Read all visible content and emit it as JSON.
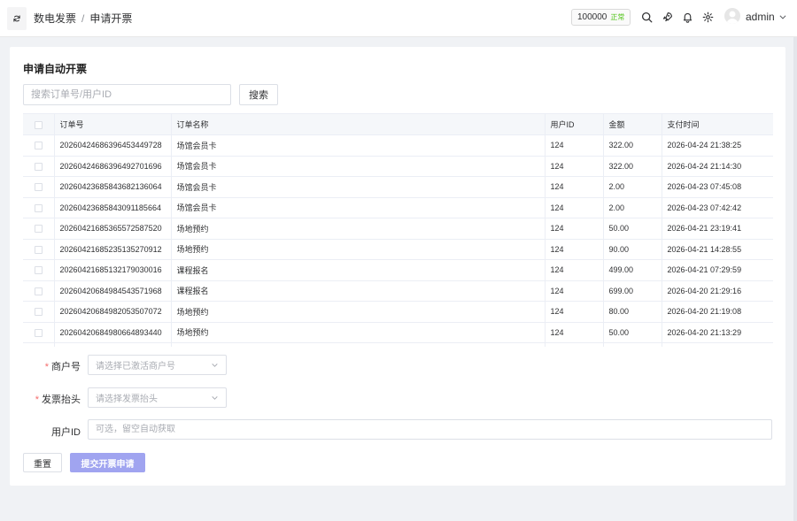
{
  "header": {
    "breadcrumb": [
      "数电发票",
      "申请开票"
    ],
    "separator": "/",
    "balance": "100000",
    "balance_status": "正常",
    "username": "admin"
  },
  "icons": {
    "refresh": "refresh-icon",
    "search": "search-icon",
    "rocket": "rocket-icon",
    "bell": "bell-icon",
    "settings": "gear-icon",
    "chevron": "chevron-down-icon"
  },
  "card": {
    "title": "申请自动开票",
    "search_placeholder": "搜索订单号/用户ID",
    "search_button": "搜索"
  },
  "table": {
    "columns": [
      "订单号",
      "订单名称",
      "用户ID",
      "金额",
      "支付时间"
    ],
    "rows": [
      [
        "20260424686396453449728",
        "场馆会员卡",
        "124",
        "322.00",
        "2026-04-24 21:38:25"
      ],
      [
        "20260424686396492701696",
        "场馆会员卡",
        "124",
        "322.00",
        "2026-04-24 21:14:30"
      ],
      [
        "20260423685843682136064",
        "场馆会员卡",
        "124",
        "2.00",
        "2026-04-23 07:45:08"
      ],
      [
        "20260423685843091185664",
        "场馆会员卡",
        "124",
        "2.00",
        "2026-04-23 07:42:42"
      ],
      [
        "20260421685365572587520",
        "场地预约",
        "124",
        "50.00",
        "2026-04-21 23:19:41"
      ],
      [
        "20260421685235135270912",
        "场地预约",
        "124",
        "90.00",
        "2026-04-21 14:28:55"
      ],
      [
        "20260421685132179030016",
        "课程报名",
        "124",
        "499.00",
        "2026-04-21 07:29:59"
      ],
      [
        "20260420684984543571968",
        "课程报名",
        "124",
        "699.00",
        "2026-04-20 21:29:16"
      ],
      [
        "20260420684982053507072",
        "场地预约",
        "124",
        "80.00",
        "2026-04-20 21:19:08"
      ],
      [
        "20260420684980664893440",
        "场地预约",
        "124",
        "50.00",
        "2026-04-20 21:13:29"
      ],
      [
        "",
        "",
        "",
        "",
        ""
      ]
    ]
  },
  "form": {
    "merchant_label": "商户号",
    "merchant_placeholder": "请选择已激活商户号",
    "title_label": "发票抬头",
    "title_placeholder": "请选择发票抬头",
    "userid_label": "用户ID",
    "userid_placeholder": "可选，留空自动获取",
    "required_mark": "*",
    "reset_button": "重置",
    "submit_button": "提交开票申请"
  },
  "colors": {
    "accent": "#a0a4f0",
    "status_ok": "#52c41a",
    "required": "#f56c6c"
  }
}
